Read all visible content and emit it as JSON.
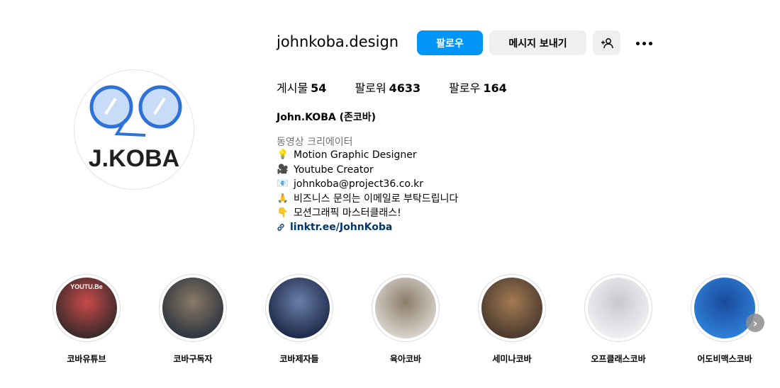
{
  "profile": {
    "username": "johnkoba.design",
    "avatar_text": "J.KOBA",
    "follow_label": "팔로우",
    "message_label": "메시지 보내기",
    "stats": {
      "posts_label": "게시물",
      "posts_count": "54",
      "followers_label": "팔로워",
      "followers_count": "4633",
      "following_label": "팔로우",
      "following_count": "164"
    },
    "full_name": "John.KOBA (존코바)",
    "category": "동영상 크리에이터",
    "bio": [
      {
        "icon": "lightbulb-icon",
        "glyph": "💡",
        "text": "Motion Graphic Designer"
      },
      {
        "icon": "video-camera-icon",
        "glyph": "🎥",
        "text": "Youtube Creator"
      },
      {
        "icon": "email-icon",
        "glyph": "📧",
        "text": "johnkoba@project36.co.kr"
      },
      {
        "icon": "pray-icon",
        "glyph": "🙏",
        "text": "비즈니스 문의는 이메일로 부탁드립니다"
      },
      {
        "icon": "pointing-hand-icon",
        "glyph": "👇",
        "text": "모션그래픽 마스터클래스!"
      }
    ],
    "link_text": "linktr.ee/JohnKoba"
  },
  "highlights": [
    {
      "label": "코바유튜브",
      "overlay": "YOUTU.Be",
      "color_a": "#3a2a2a",
      "color_b": "#c94a4a"
    },
    {
      "label": "코바구독자",
      "overlay": "",
      "color_a": "#2f3540",
      "color_b": "#8a7a66"
    },
    {
      "label": "코바제자들",
      "overlay": "",
      "color_a": "#1e2a4a",
      "color_b": "#6a7fa8"
    },
    {
      "label": "육아코바",
      "overlay": "",
      "color_a": "#d8d4cc",
      "color_b": "#8c7c6a"
    },
    {
      "label": "세미나코바",
      "overlay": "",
      "color_a": "#4a3a2e",
      "color_b": "#a47a52"
    },
    {
      "label": "오프클래스코바",
      "overlay": "",
      "color_a": "#efeff2",
      "color_b": "#c8c8d0"
    },
    {
      "label": "어도비맥스코바",
      "overlay": "",
      "color_a": "#2d7fd8",
      "color_b": "#1a4a9a"
    }
  ],
  "colors": {
    "accent": "#0095f6",
    "link": "#00376b",
    "muted": "#737373",
    "logo_blue": "#2f72d6"
  }
}
